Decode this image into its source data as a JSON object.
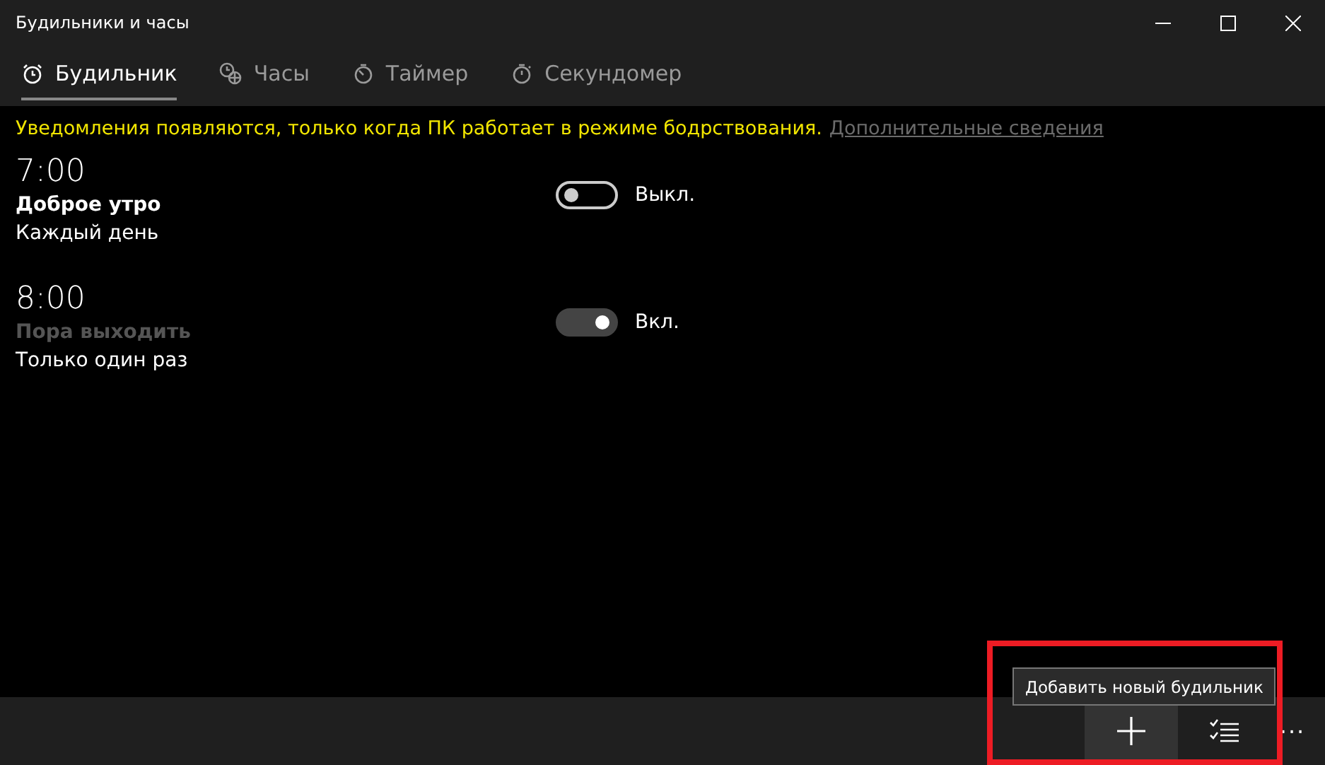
{
  "window": {
    "title": "Будильники и часы"
  },
  "tabs": [
    {
      "label": "Будильник",
      "kind": "alarm",
      "selected": true
    },
    {
      "label": "Часы",
      "kind": "world",
      "selected": false
    },
    {
      "label": "Таймер",
      "kind": "timer",
      "selected": false
    },
    {
      "label": "Секундомер",
      "kind": "stopwatch",
      "selected": false
    }
  ],
  "notice": {
    "text": "Уведомления появляются, только когда ПК работает в режиме бодрствования.",
    "link": "Дополнительные сведения"
  },
  "alarms": [
    {
      "time": "7:00",
      "name": "Доброе утро",
      "name_dimmed": false,
      "repeat": "Каждый день",
      "on": false,
      "state_label": "Выкл."
    },
    {
      "time": "8:00",
      "name": "Пора выходить",
      "name_dimmed": true,
      "repeat": "Только один раз",
      "on": true,
      "state_label": "Вкл."
    }
  ],
  "command_bar": {
    "buttons": [
      {
        "kind": "add",
        "hovered": true
      },
      {
        "kind": "select",
        "hovered": false
      }
    ],
    "more": "···",
    "tooltip": "Добавить новый будильник"
  },
  "highlight_frame": true
}
